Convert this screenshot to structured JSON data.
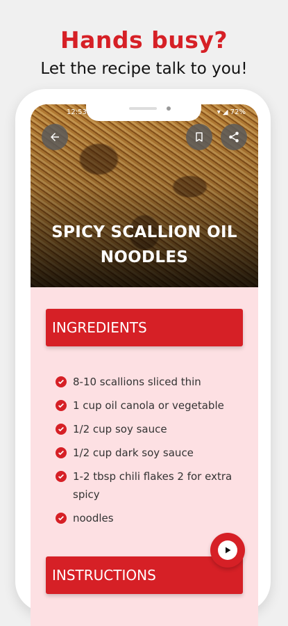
{
  "promo": {
    "headline": "Hands busy?",
    "subhead": "Let the recipe talk to you!"
  },
  "status_bar": {
    "time": "12:53",
    "right": "▾ ◢ 72%"
  },
  "recipe": {
    "title": "SPICY SCALLION OIL NOODLES"
  },
  "sections": {
    "ingredients_label": "INGREDIENTS",
    "instructions_label": "INSTRUCTIONS"
  },
  "ingredients": [
    "8-10 scallions sliced thin",
    "1 cup oil canola or vegetable",
    "1/2 cup soy sauce",
    "1/2 cup dark soy sauce",
    "1-2 tbsp chili flakes 2 for extra spicy",
    "noodles"
  ],
  "colors": {
    "accent": "#d62026",
    "content_bg": "#fde0e3"
  },
  "icons": {
    "back": "arrow-left-icon",
    "bookmark": "bookmark-icon",
    "share": "share-icon",
    "play": "play-icon",
    "check": "check-circle-icon"
  }
}
